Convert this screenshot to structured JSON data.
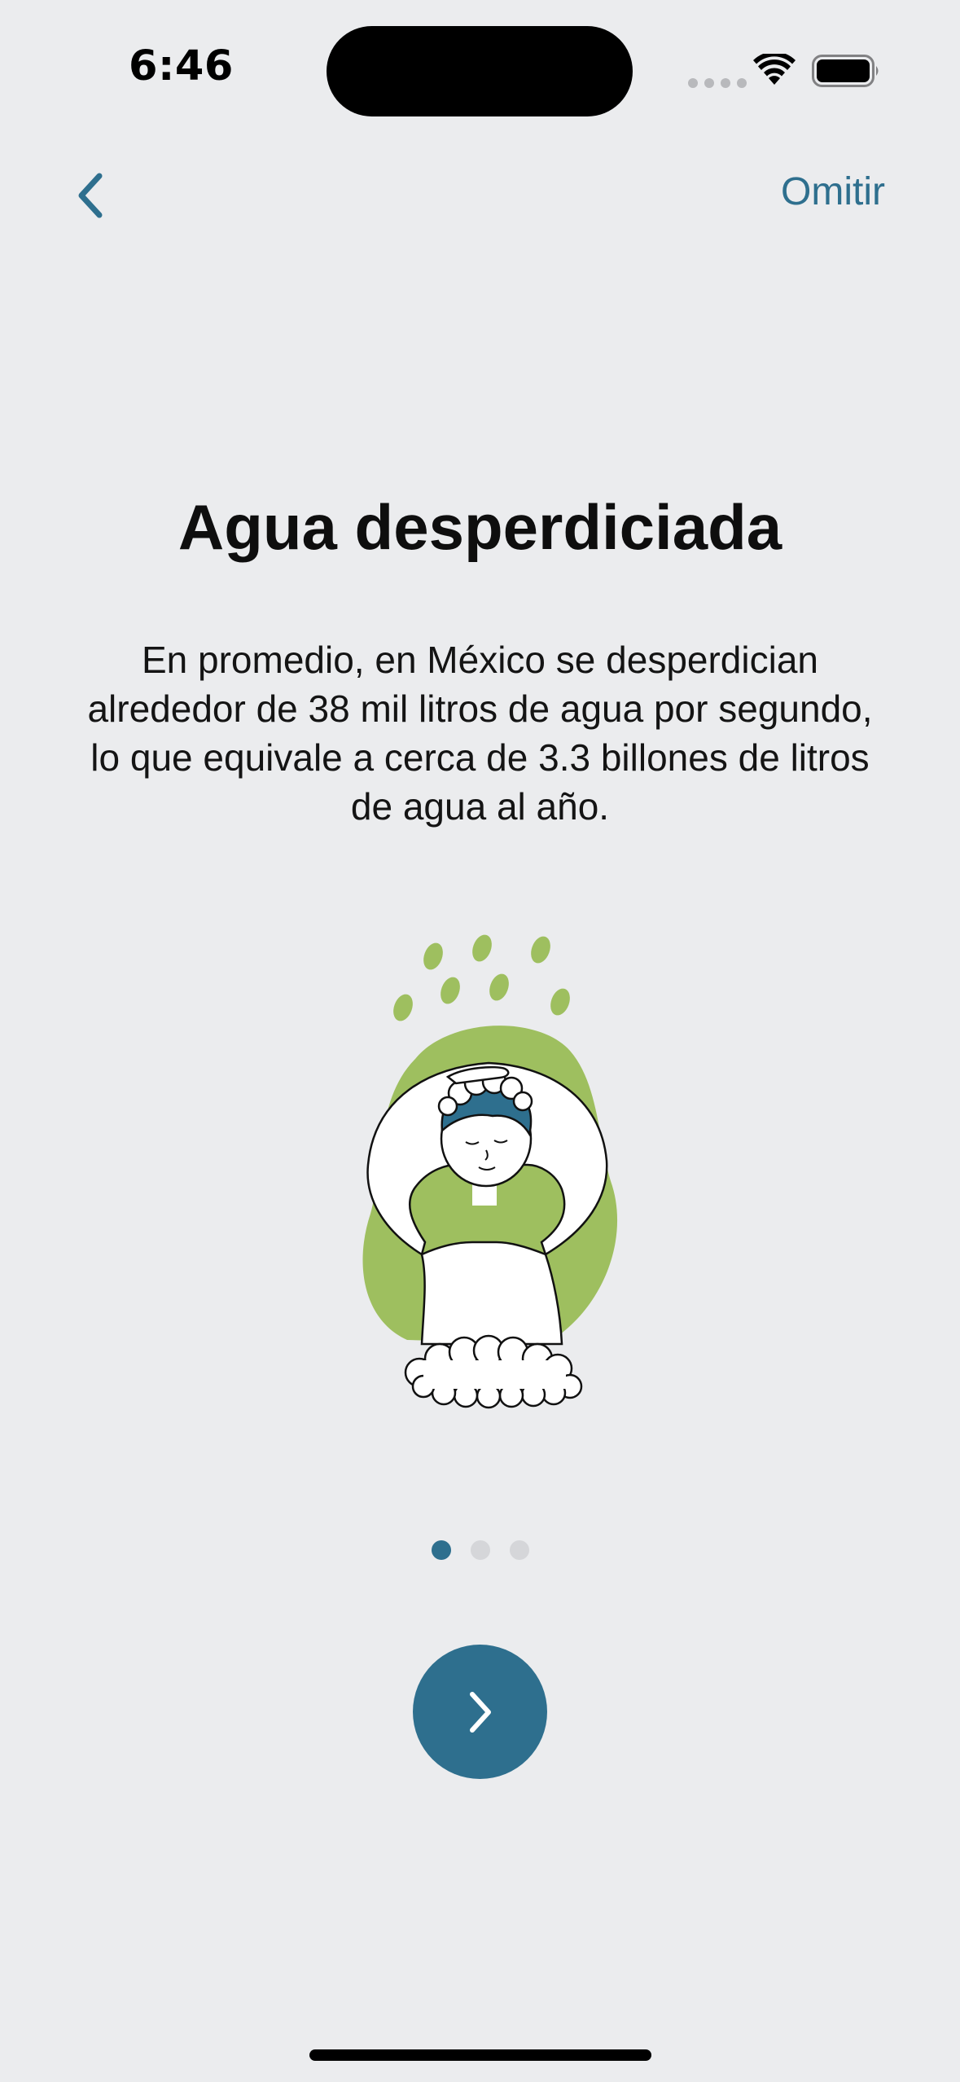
{
  "status_bar": {
    "time": "6:46"
  },
  "nav": {
    "back_icon": "chevron-left-icon",
    "skip_label": "Omitir"
  },
  "content": {
    "title": "Agua desperdiciada",
    "description": "En promedio, en México se desperdician alrededor de 38 mil litros de agua por segundo, lo que equivale a cerca de 3.3 billones de litros de agua al año."
  },
  "pager": {
    "total": 3,
    "current": 1
  },
  "next_button": {
    "icon": "chevron-right-icon"
  },
  "colors": {
    "accent": "#2E6F8E",
    "illustration_green": "#9EBF5F",
    "background": "#EBECEE"
  }
}
